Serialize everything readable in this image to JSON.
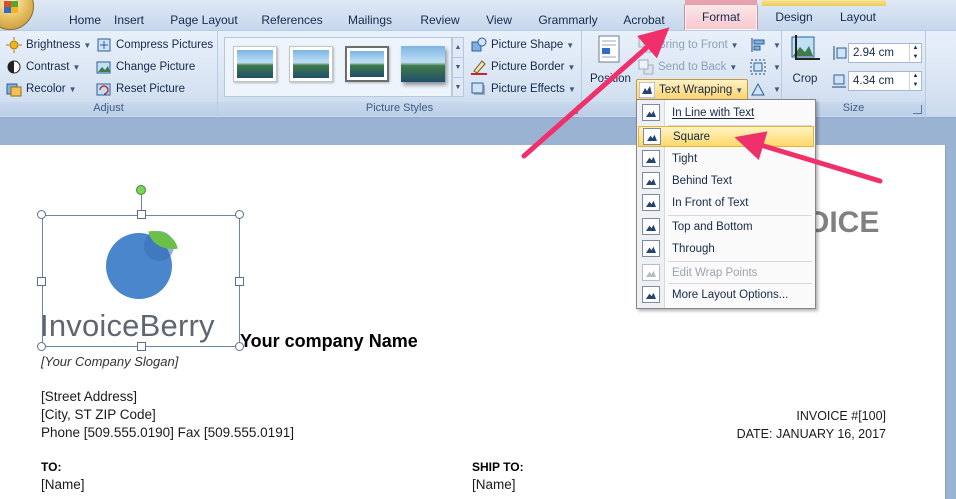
{
  "tabs": [
    {
      "label": "Home"
    },
    {
      "label": "Insert"
    },
    {
      "label": "Page Layout"
    },
    {
      "label": "References"
    },
    {
      "label": "Mailings"
    },
    {
      "label": "Review"
    },
    {
      "label": "View"
    },
    {
      "label": "Grammarly"
    },
    {
      "label": "Acrobat"
    },
    {
      "label": "Format",
      "active": true
    },
    {
      "label": "Design"
    },
    {
      "label": "Layout"
    }
  ],
  "ribbon": {
    "adjust": {
      "label": "Adjust",
      "brightness": "Brightness",
      "contrast": "Contrast",
      "recolor": "Recolor",
      "compress": "Compress Pictures",
      "change": "Change Picture",
      "reset": "Reset Picture"
    },
    "picture_styles": {
      "label": "Picture Styles",
      "shape": "Picture Shape",
      "border": "Picture Border",
      "effects": "Picture Effects"
    },
    "arrange": {
      "position": "Position",
      "bring_to_front": "Bring to Front",
      "send_to_back": "Send to Back",
      "text_wrapping": "Text Wrapping"
    },
    "size": {
      "label": "Size",
      "crop": "Crop",
      "height": "2.94 cm",
      "width": "4.34 cm"
    }
  },
  "wrap_menu": {
    "items": [
      {
        "label": "In Line with Text",
        "mnemonic": "I"
      },
      {
        "label": "Square",
        "mnemonic": "S",
        "highlighted": true
      },
      {
        "label": "Tight",
        "mnemonic": "T"
      },
      {
        "label": "Behind Text",
        "mnemonic": "D"
      },
      {
        "label": "In Front of Text",
        "mnemonic": "N"
      },
      {
        "label": "Top and Bottom",
        "mnemonic": "O"
      },
      {
        "label": "Through",
        "mnemonic": "H"
      },
      {
        "label": "Edit Wrap Points",
        "mnemonic": "E",
        "disabled": true
      },
      {
        "label": "More Layout Options...",
        "mnemonic": "L"
      }
    ]
  },
  "document": {
    "logo_text": "InvoiceBerry",
    "company_name": "Your company Name",
    "slogan": "[Your Company Slogan]",
    "street": "[Street Address]",
    "city": "[City, ST  ZIP Code]",
    "phone": "Phone [509.555.0190]  Fax [509.555.0191]",
    "invoice_title": "OICE",
    "invoice_number": "INVOICE #[100]",
    "date": "DATE: JANUARY 16, 2017",
    "to_label": "TO:",
    "to_name": "[Name]",
    "ship_label": "SHIP TO:",
    "ship_name": "[Name]"
  },
  "colors": {
    "annotation_arrow": "#f0306a",
    "format_tab": "#f7c7cf",
    "menu_highlight": "#ffd86a",
    "logo_blue": "#4a86cc",
    "logo_leaf": "#6cc04a"
  }
}
